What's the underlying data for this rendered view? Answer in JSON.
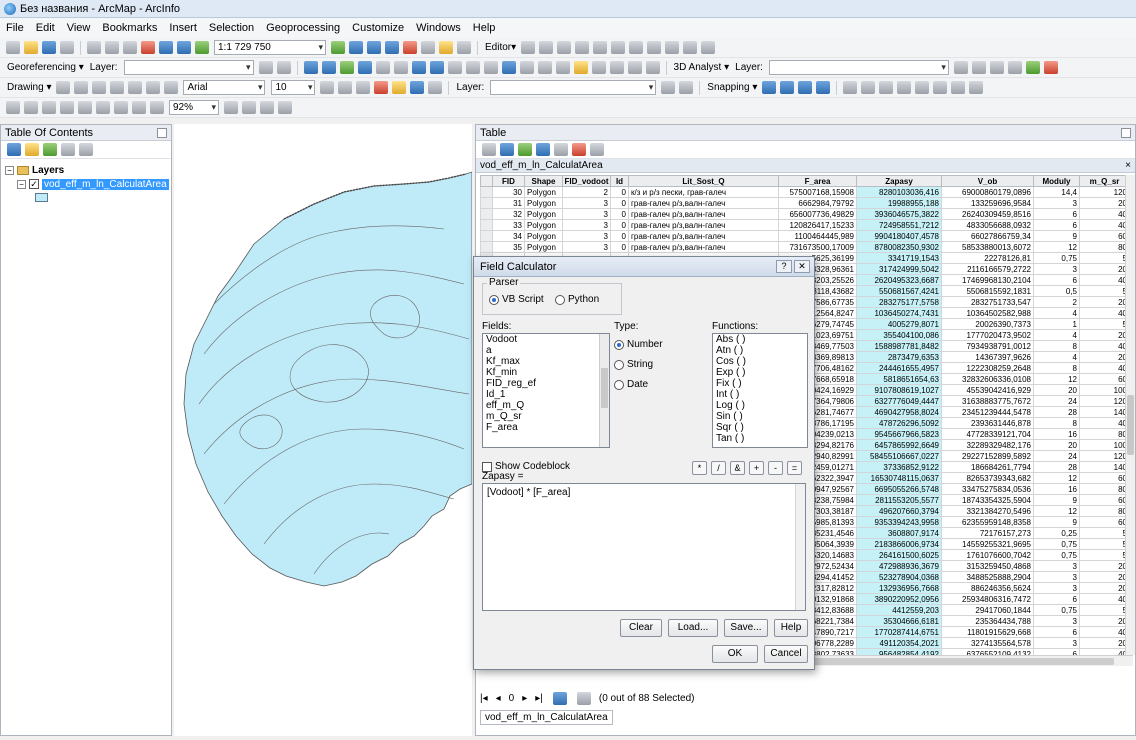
{
  "window": {
    "title": "Без названия - ArcMap - ArcInfo"
  },
  "menu": [
    "File",
    "Edit",
    "View",
    "Bookmarks",
    "Insert",
    "Selection",
    "Geoprocessing",
    "Customize",
    "Windows",
    "Help"
  ],
  "toolbars": {
    "scale": "1:1 729 750",
    "editor": "Editor▾",
    "georef": "Georeferencing ▾",
    "layer_label": "Layer:",
    "drawing": "Drawing ▾",
    "font": "Arial",
    "font_size": "10",
    "snapping": "Snapping ▾",
    "analyst": "3D Analyst ▾",
    "zoom": "92%"
  },
  "toc": {
    "title": "Table Of Contents",
    "layers_label": "Layers",
    "layer_name": "vod_eff_m_ln_CalculatArea"
  },
  "table": {
    "title": "Table",
    "tab_name": "vod_eff_m_ln_CalculatArea",
    "columns": [
      "FID",
      "Shape",
      "FID_vodoot",
      "Id",
      "Lit_Sost_Q",
      "F_area",
      "Zapasy",
      "V_ob",
      "Moduly",
      "m_Q_sr"
    ],
    "rows": [
      [
        "30",
        "Polygon",
        "2",
        "0",
        "к/з и р/з пески, грав-галеч",
        "575007168,15908",
        "8280103036,416",
        "69000860179,0896",
        "14,4",
        "120"
      ],
      [
        "31",
        "Polygon",
        "3",
        "0",
        "грав-галеч р/з,валн-галеч",
        "6662984,79792",
        "19988955,188",
        "133259696,9584",
        "3",
        "20"
      ],
      [
        "32",
        "Polygon",
        "3",
        "0",
        "грав-галеч р/з,валн-галеч",
        "656007736,49829",
        "3936046575,3822",
        "26240309459,8516",
        "6",
        "40"
      ],
      [
        "33",
        "Polygon",
        "3",
        "0",
        "грав-галеч р/з,валн-галеч",
        "120826417,15233",
        "724958551,7212",
        "4833056688,0932",
        "6",
        "40"
      ],
      [
        "34",
        "Polygon",
        "3",
        "0",
        "грав-галеч р/з,валн-галеч",
        "1100464445,989",
        "9904180407,4578",
        "66027866759,34",
        "9",
        "60"
      ],
      [
        "35",
        "Polygon",
        "3",
        "0",
        "грав-галеч р/з,валн-галеч",
        "731673500,17009",
        "8780082350,9302",
        "58533880013,6072",
        "12",
        "80"
      ],
      [
        "",
        "",
        "",
        "",
        "",
        "5625,36199",
        "3341719,1543",
        "22278126,81",
        "0,75",
        "5"
      ],
      [
        "",
        "",
        "",
        "",
        "",
        "8328,96361",
        "317424999,5042",
        "2116166579,2722",
        "3",
        "20"
      ],
      [
        "",
        "",
        "",
        "",
        "",
        "8203,25526",
        "2620495323,6687",
        "17469968130,2104",
        "6",
        "40"
      ],
      [
        "",
        "",
        "",
        "",
        "",
        "3118,43682",
        "550681567,4241",
        "5506815592,1831",
        "0,5",
        "5"
      ],
      [
        "",
        "",
        "",
        "",
        "",
        "7586,67735",
        "283275177,5758",
        "2832751733,547",
        "2",
        "20"
      ],
      [
        "",
        "",
        "",
        "",
        "",
        "12564,8247",
        "1036450274,7431",
        "10364502582,988",
        "4",
        "40"
      ],
      [
        "",
        "",
        "",
        "",
        "",
        "6279,74745",
        "4005279,8071",
        "20026390,7373",
        "1",
        "5"
      ],
      [
        "",
        "",
        "",
        "",
        "",
        "1023,69751",
        "355404100,086",
        "1777020473,9502",
        "4",
        "20"
      ],
      [
        "",
        "",
        "",
        "",
        "",
        "3469,77503",
        "1588987781,8482",
        "7934938791,0012",
        "8",
        "40"
      ],
      [
        "",
        "",
        "",
        "",
        "",
        "8369,89813",
        "2873479,6353",
        "14367397,9626",
        "4",
        "20"
      ],
      [
        "",
        "",
        "",
        "",
        "",
        "7706,48162",
        "244461655,4957",
        "1222308259,2648",
        "8",
        "40"
      ],
      [
        "",
        "",
        "",
        "",
        "",
        "7668,65918",
        "5818651654,63",
        "32832606336,0108",
        "12",
        "60"
      ],
      [
        "",
        "",
        "",
        "",
        "",
        "0424,16929",
        "9107808619,1027",
        "45539042416,929",
        "20",
        "100"
      ],
      [
        "",
        "",
        "",
        "",
        "",
        "7364,79806",
        "6327776049,4447",
        "31638883775,7672",
        "24",
        "120"
      ],
      [
        "",
        "",
        "",
        "",
        "",
        "6281,74677",
        "4690427958,8024",
        "23451239444,5478",
        "28",
        "140"
      ],
      [
        "",
        "",
        "",
        "",
        "",
        "8786,17195",
        "478726296,5092",
        "2393631446,878",
        "8",
        "40"
      ],
      [
        "",
        "",
        "",
        "",
        "",
        "04239,0213",
        "9545667966,5823",
        "47728339121,704",
        "16",
        "80"
      ],
      [
        "",
        "",
        "",
        "",
        "",
        "3294,82176",
        "6457865992,6649",
        "32289329482,176",
        "20",
        "100"
      ],
      [
        "",
        "",
        "",
        "",
        "",
        "2940,82991",
        "58455106667,0227",
        "29227152899,5892",
        "24",
        "120"
      ],
      [
        "",
        "",
        "",
        "",
        "",
        "2459,01271",
        "37336852,9122",
        "186684261,7794",
        "28",
        "140"
      ],
      [
        "",
        "",
        "",
        "",
        "",
        "62322,3947",
        "16530748115,0637",
        "82653739343,682",
        "12",
        "60"
      ],
      [
        "",
        "",
        "",
        "",
        "",
        "0947,92567",
        "6695055266,5748",
        "33475275834,0536",
        "16",
        "80"
      ],
      [
        "",
        "",
        "",
        "",
        "",
        "8238,75984",
        "2811553205,5577",
        "18743354325,5904",
        "9",
        "60"
      ],
      [
        "",
        "",
        "",
        "",
        "",
        "7303,38187",
        "496207660,3794",
        "3321384270,5496",
        "12",
        "80"
      ],
      [
        "",
        "",
        "",
        "",
        "",
        "5985,81393",
        "9353394243,9958",
        "62355959148,8358",
        "9",
        "60"
      ],
      [
        "",
        "",
        "",
        "",
        "",
        "35231,4546",
        "3608807,9174",
        "72176157,273",
        "0,25",
        "5"
      ],
      [
        "",
        "",
        "",
        "",
        "",
        "85064,3939",
        "2183866006,9734",
        "14559255321,9695",
        "0,75",
        "5"
      ],
      [
        "",
        "",
        "",
        "",
        "",
        "5320,14683",
        "264161500,6025",
        "1761076600,7042",
        "0,75",
        "5"
      ],
      [
        "",
        "",
        "",
        "",
        "",
        "2972,52434",
        "472988936,3679",
        "3153259450,4868",
        "3",
        "20"
      ],
      [
        "",
        "",
        "",
        "",
        "",
        "8294,41452",
        "523278904,0368",
        "3488525888,2904",
        "3",
        "20"
      ],
      [
        "",
        "",
        "",
        "",
        "",
        "2317,82812",
        "132936956,7668",
        "886246356,5624",
        "3",
        "20"
      ],
      [
        "",
        "",
        "",
        "",
        "",
        "0132,91868",
        "3890220952,0956",
        "25934806316,7472",
        "6",
        "40"
      ],
      [
        "",
        "",
        "",
        "",
        "",
        "3412,83688",
        "4412559,203",
        "29417060,1844",
        "0,75",
        "5"
      ],
      [
        "",
        "",
        "",
        "",
        "",
        "68221,7384",
        "35304666,6181",
        "235364434,788",
        "3",
        "20"
      ],
      [
        "",
        "",
        "",
        "",
        "",
        "47890,7217",
        "1770287414,6751",
        "11801915629,668",
        "6",
        "40"
      ],
      [
        "",
        "",
        "",
        "",
        "",
        "06778,2289",
        "491120354,2021",
        "3274135564,578",
        "3",
        "20"
      ],
      [
        "",
        "",
        "",
        "",
        "",
        "3802,73633",
        "956482854,4192",
        "6376552109,4132",
        "6",
        "40"
      ],
      [
        "",
        "",
        "",
        "",
        "",
        "5461,08016",
        "1516639389,9673",
        "10110928864,8096",
        "9",
        "60"
      ],
      [
        "",
        "",
        "",
        "",
        "",
        "156727,463",
        "8132351239,0956",
        "54215672748,3",
        "15",
        "100"
      ],
      [
        "",
        "",
        "",
        "",
        "",
        "1296,34055",
        "10584203754,7084",
        "70561355680,866",
        "18",
        "120"
      ]
    ],
    "nav_record": "0",
    "selected_info": "(0 out of 88 Selected)"
  },
  "dialog": {
    "title": "Field Calculator",
    "parser_label": "Parser",
    "parser_vb": "VB Script",
    "parser_py": "Python",
    "fields_label": "Fields:",
    "fields": [
      "Vodoot",
      "a",
      "Kf_max",
      "Kf_min",
      "FID_reg_ef",
      "Id_1",
      "eff_m_Q",
      "m_Q_sr",
      "F_area"
    ],
    "type_label": "Type:",
    "type_number": "Number",
    "type_string": "String",
    "type_date": "Date",
    "functions_label": "Functions:",
    "functions": [
      "Abs ( )",
      "Atn ( )",
      "Cos ( )",
      "Exp ( )",
      "Fix ( )",
      "Int ( )",
      "Log ( )",
      "Sin ( )",
      "Sqr ( )",
      "Tan ( )"
    ],
    "codeblock_label": "Show Codeblock",
    "target_label": "Zapasy =",
    "expression": "[Vodoot] * [F_area]",
    "ops": [
      "*",
      "/",
      "&",
      "+",
      "-",
      "="
    ],
    "btn_clear": "Clear",
    "btn_load": "Load...",
    "btn_save": "Save...",
    "btn_help": "Help",
    "btn_ok": "OK",
    "btn_cancel": "Cancel"
  }
}
